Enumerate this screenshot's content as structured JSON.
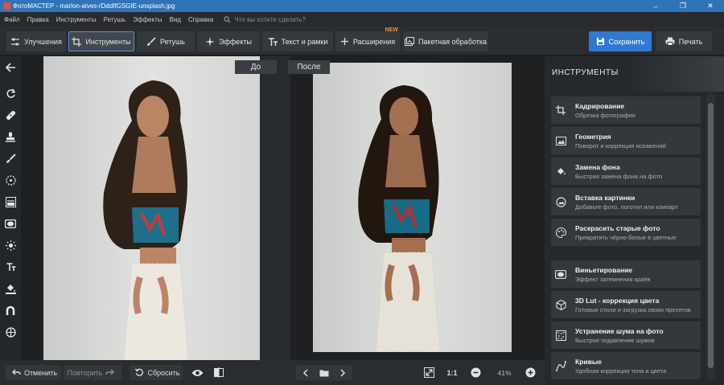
{
  "window": {
    "title": "ФотоМАСТЕР - marlon-alves-rDddIfGSGIE-unsplash.jpg",
    "minimize": "–",
    "maximize": "❐",
    "close": "✕"
  },
  "menu": {
    "items": [
      "Файл",
      "Правка",
      "Инструменты",
      "Ретушь",
      "Эффекты",
      "Вид",
      "Справка"
    ],
    "search_placeholder": "Что вы хотите сделать?"
  },
  "toolbar": {
    "tabs": [
      {
        "label": "Улучшения",
        "icon": "sliders-icon"
      },
      {
        "label": "Инструменты",
        "icon": "crop-icon",
        "active": true
      },
      {
        "label": "Ретушь",
        "icon": "brush-icon"
      },
      {
        "label": "Эффекты",
        "icon": "sparkle-icon"
      },
      {
        "label": "Текст и рамки",
        "icon": "text-icon"
      },
      {
        "label": "Расширения",
        "icon": "plus-icon",
        "badge": "NEW"
      },
      {
        "label": "Пакетная обработка",
        "icon": "batch-icon"
      }
    ],
    "save_label": "Сохранить",
    "print_label": "Печать"
  },
  "leftbar": {
    "icons": [
      "back-arrow-icon",
      "rotate-icon",
      "healing-icon",
      "stamp-icon",
      "brush-icon",
      "radial-icon",
      "gradient-icon",
      "vignette-icon",
      "light-icon",
      "text-icon",
      "fill-icon",
      "magnet-icon",
      "globe-icon"
    ]
  },
  "canvas": {
    "label_before": "До",
    "label_after": "После"
  },
  "panel": {
    "title": "ИНСТРУМЕНТЫ",
    "tools": [
      {
        "title": "Кадрирование",
        "subtitle": "Обрезка фотографии",
        "icon": "crop-icon"
      },
      {
        "title": "Геометрия",
        "subtitle": "Поворот и коррекция искажений",
        "icon": "geometry-icon"
      },
      {
        "title": "Замена фона",
        "subtitle": "Быстрая замена фона на фото",
        "icon": "bucket-icon"
      },
      {
        "title": "Вставка картинки",
        "subtitle": "Добавьте фото, логотип или клипарт",
        "icon": "insert-image-icon"
      },
      {
        "title": "Раскрасить старые фото",
        "subtitle": "Превратить чёрно-белые в цветные",
        "icon": "palette-icon"
      },
      {
        "title": "Виньетирование",
        "subtitle": "Эффект затемнения краёв",
        "icon": "vignette-icon"
      },
      {
        "title": "3D Lut - коррекция цвета",
        "subtitle": "Готовые стили и загрузка своих пресетов",
        "icon": "cube-icon"
      },
      {
        "title": "Устранение шума на фото",
        "subtitle": "Быстрое подавление шумов",
        "icon": "noise-icon"
      },
      {
        "title": "Кривые",
        "subtitle": "Удобная коррекция тона и цвета",
        "icon": "curves-icon"
      }
    ]
  },
  "bottombar": {
    "undo_label": "Отменить",
    "redo_label": "Повторить",
    "reset_label": "Сбросить",
    "ratio_label": "1:1",
    "zoom_value": "41%"
  },
  "colors": {
    "accent": "#2f7ad0",
    "titlebar": "#2f73b8",
    "badge": "#ff8a1e"
  }
}
